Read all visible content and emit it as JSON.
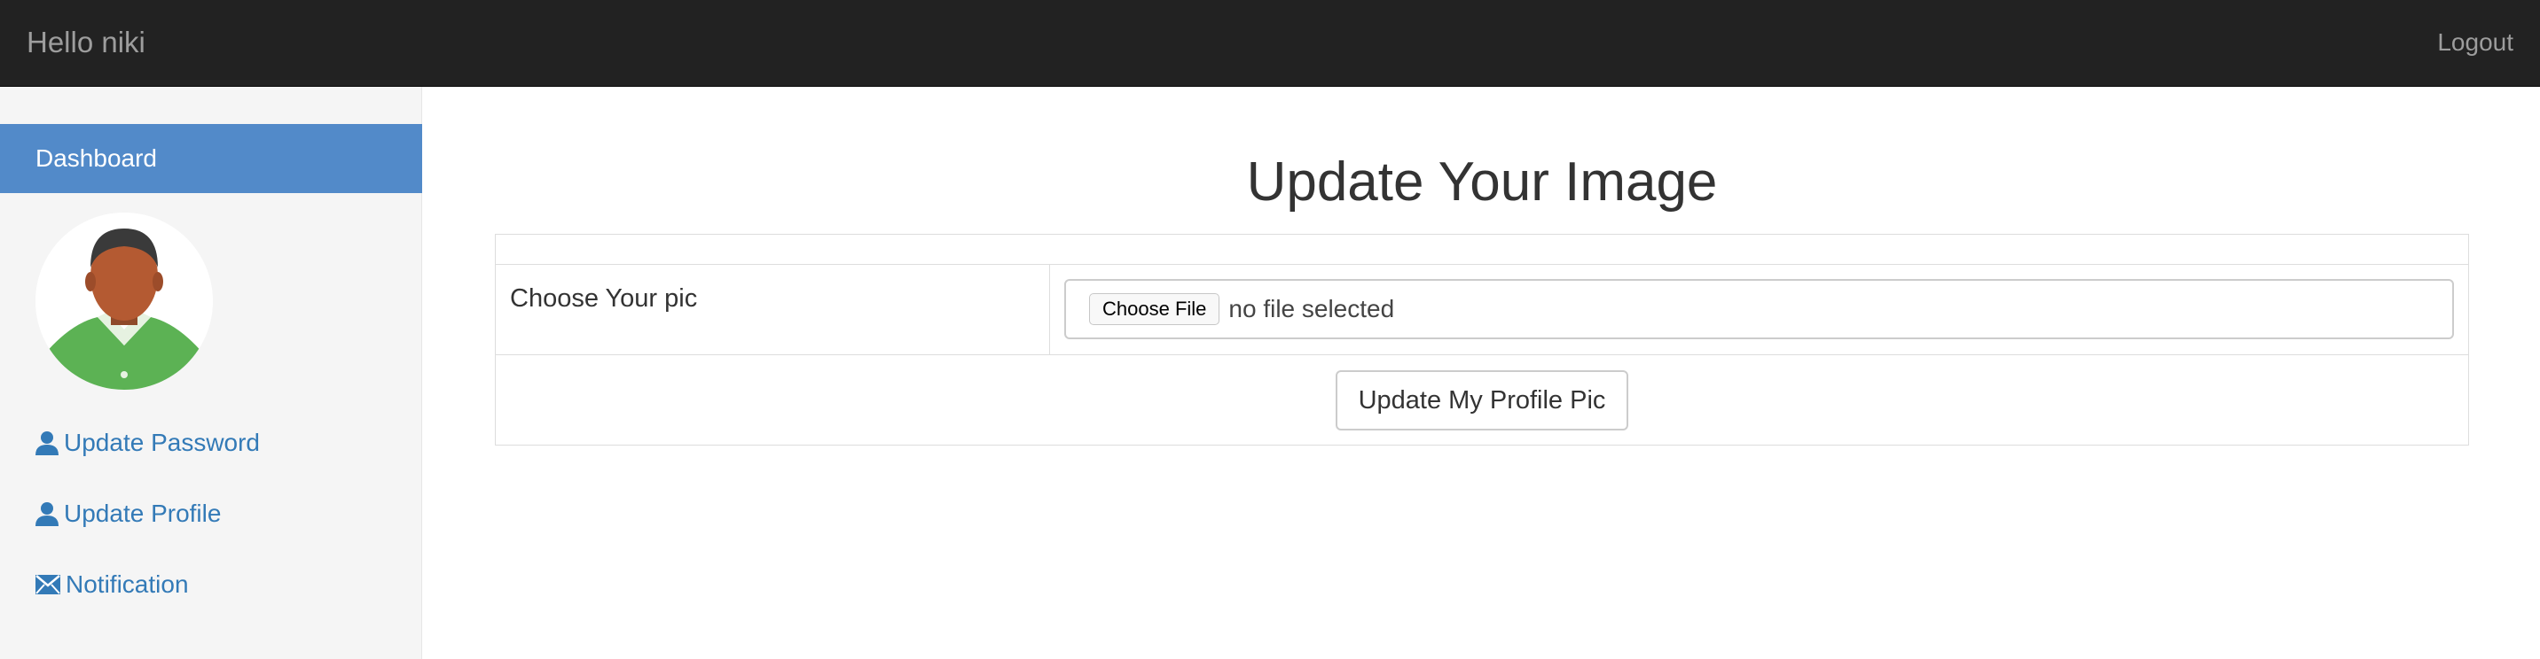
{
  "navbar": {
    "brand": "Hello niki",
    "logout_label": "Logout"
  },
  "sidebar": {
    "dashboard_label": "Dashboard",
    "avatar_icon": "user-avatar",
    "items": [
      {
        "label": "Update Password",
        "icon": "user-icon"
      },
      {
        "label": "Update Profile",
        "icon": "user-icon"
      },
      {
        "label": "Notification",
        "icon": "envelope-icon"
      }
    ]
  },
  "main": {
    "title": "Update Your Image",
    "file_row_label": "Choose Your pic",
    "choose_file_label": "Choose File",
    "file_status": "no file selected",
    "submit_label": "Update My Profile Pic"
  },
  "colors": {
    "navbar_bg": "#222222",
    "active_item_bg": "#528ac9",
    "link": "#337ab7",
    "sidebar_bg": "#f5f5f5"
  }
}
